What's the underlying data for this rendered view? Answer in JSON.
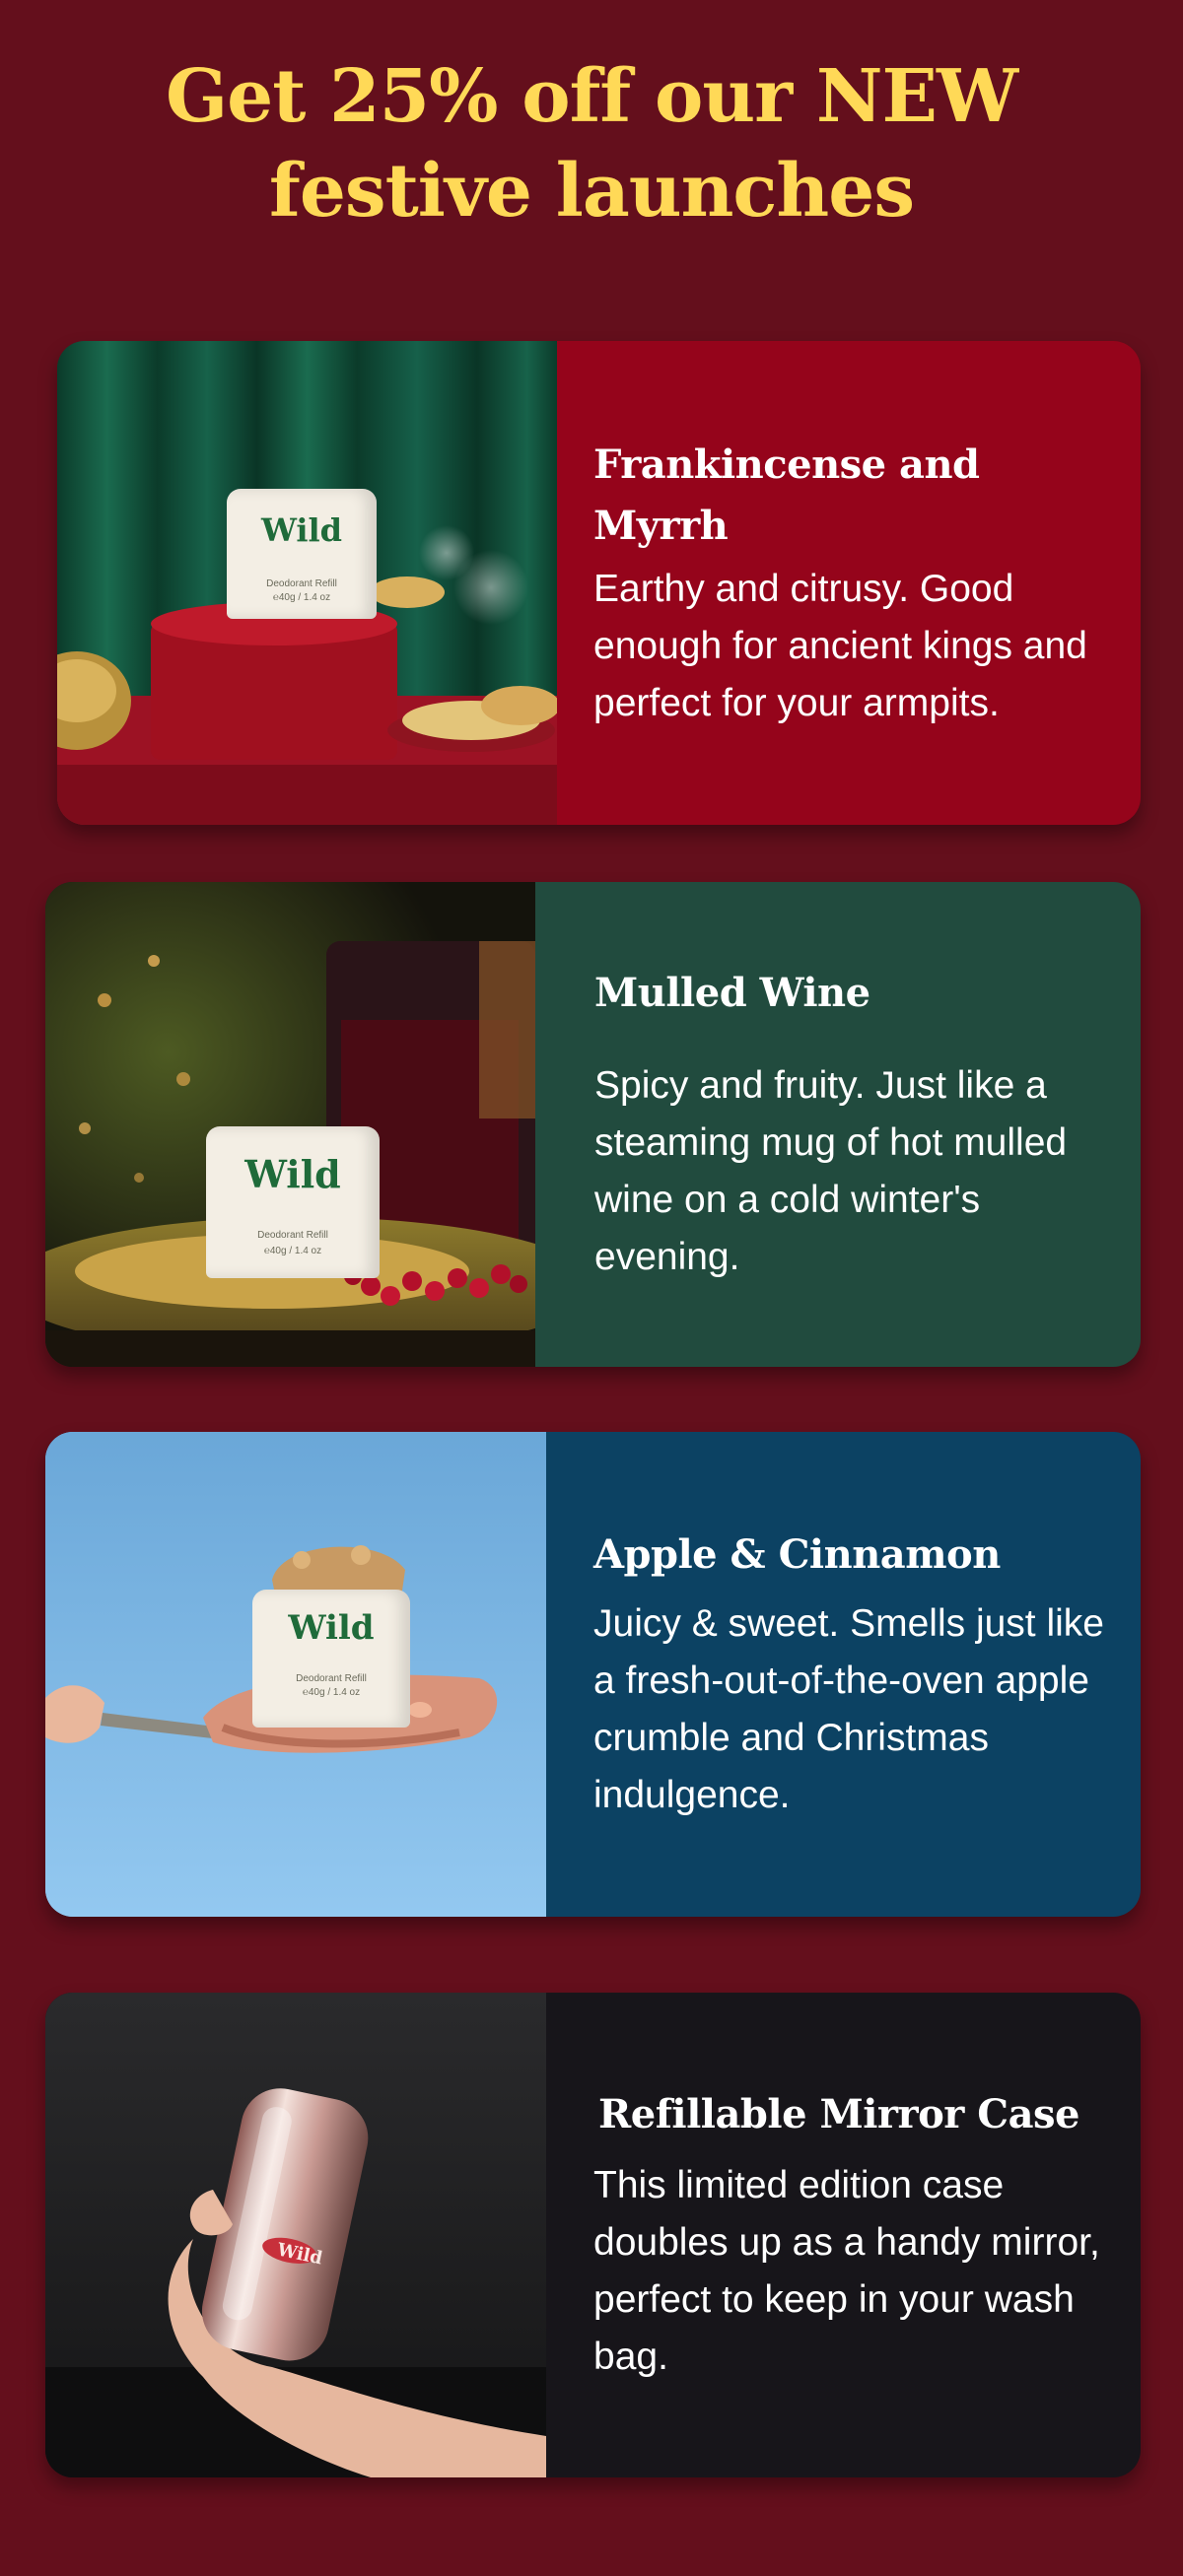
{
  "headline": {
    "line1": "Get 25% off our NEW",
    "line2": "festive launches"
  },
  "colors": {
    "page_background": "#640f1c",
    "headline": "#ffd957",
    "card_frankincense": "#95041b",
    "card_mulled_wine": "#214b3e",
    "card_apple": "#0c4263",
    "card_mirror": "#17151a"
  },
  "products": [
    {
      "title_line1": "Frankincense and",
      "title_line2": "Myrrh",
      "description": "Earthy and citrusy. Good enough for ancient kings and perfect for your armpits.",
      "image_alt": "Wild deodorant refill with frankincense and myrrh",
      "pot_brand": "Wild",
      "pot_label": "Deodorant Refill",
      "pot_weight": "℮40g / 1.4 oz"
    },
    {
      "title": "Mulled Wine",
      "description": "Spicy and fruity. Just like a steaming mug of hot mulled wine on a cold winter's evening.",
      "image_alt": "Wild deodorant refill with mulled wine and berries",
      "pot_brand": "Wild",
      "pot_label": "Deodorant Refill",
      "pot_weight": "℮40g / 1.4 oz"
    },
    {
      "title": "Apple & Cinnamon",
      "description": "Juicy & sweet. Smells just like a fresh-out-of-the-oven apple crumble and Christmas indulgence.",
      "image_alt": "Wild deodorant refill on apple crumble",
      "pot_brand": "Wild",
      "pot_label": "Deodorant Refill",
      "pot_weight": "℮40g / 1.4 oz"
    },
    {
      "title": "Refillable Mirror Case",
      "description": "This limited edition case doubles up as a handy mirror, perfect to keep in your wash bag.",
      "image_alt": "Hand holding refillable mirror deodorant case",
      "case_brand": "Wild"
    }
  ]
}
